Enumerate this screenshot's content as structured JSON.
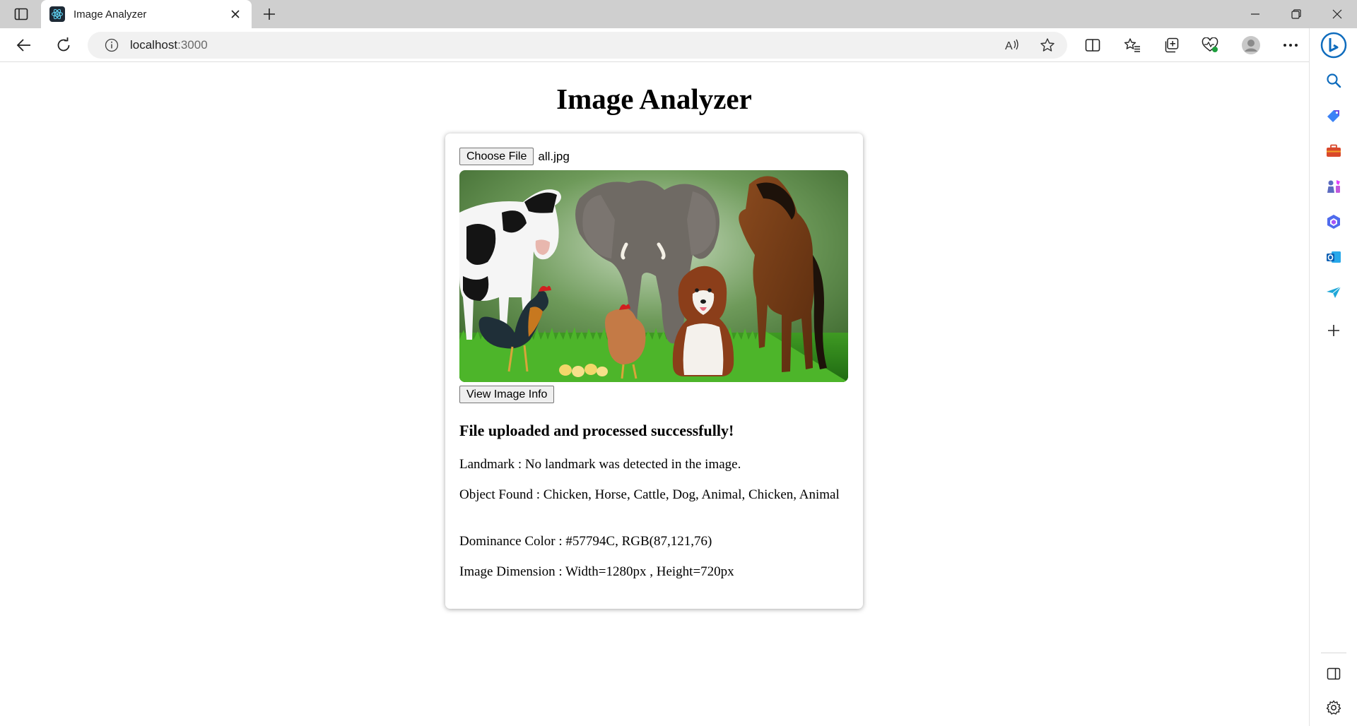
{
  "browser": {
    "tab_title": "Image Analyzer",
    "url_host": "localhost",
    "url_port": ":3000"
  },
  "page": {
    "title": "Image Analyzer",
    "choose_file_label": "Choose File",
    "file_name": "all.jpg",
    "image_alt": "Uploaded image: cow, elephant, horse, dog, rooster, hen and chicks on grass",
    "view_button_label": "View Image Info",
    "status_heading": "File uploaded and processed successfully!",
    "results": [
      {
        "label": "Landmark",
        "value": "No landmark was detected in the image."
      },
      {
        "label": "Object Found",
        "value": "Chicken, Horse, Cattle, Dog, Animal, Chicken, Animal"
      },
      {
        "label": "Dominance Color",
        "value": "#57794C, RGB(87,121,76)"
      },
      {
        "label": "Image Dimension",
        "value": "Width=1280px , Height=720px"
      }
    ]
  },
  "icons": {
    "titlebar": [
      "tab-actions-icon",
      "react-favicon-icon",
      "close-icon",
      "plus-icon",
      "minimize-icon",
      "restore-icon",
      "close-window-icon"
    ],
    "toolbar": [
      "back-icon",
      "refresh-icon",
      "info-icon",
      "read-aloud-icon",
      "favorite-star-icon",
      "split-screen-icon",
      "favorites-icon",
      "collections-icon",
      "browser-essentials-icon",
      "profile-icon",
      "more-icon",
      "copilot-icon"
    ],
    "sidebar": [
      "search-icon",
      "shopping-icon",
      "tools-icon",
      "games-icon",
      "microsoft365-icon",
      "outlook-icon",
      "send-icon",
      "add-icon",
      "hide-sidebar-icon",
      "settings-icon"
    ]
  },
  "colors": {
    "titlebar": "#cfcfcf",
    "accent_blue": "#0f6cbd",
    "dominant_color": "#57794C"
  }
}
